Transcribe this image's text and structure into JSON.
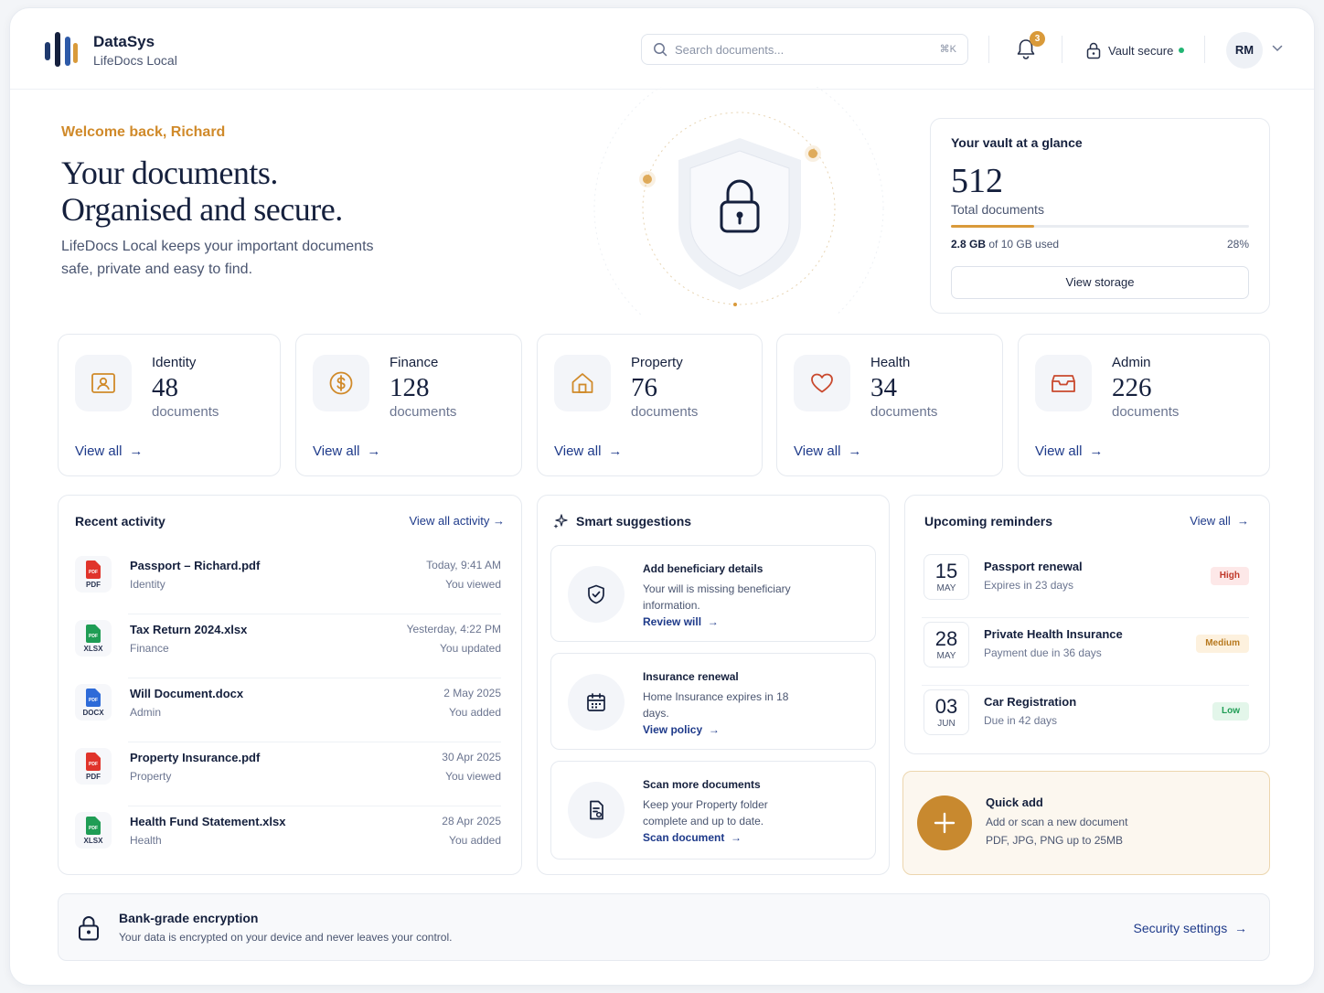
{
  "brand": {
    "name": "DataSys",
    "product": "LifeDocs Local"
  },
  "header": {
    "search_placeholder": "Search documents...",
    "search_shortcut": "⌘K",
    "notification_count": "3",
    "vault_status": "Vault secure",
    "user_initials": "RM"
  },
  "hero": {
    "welcome": "Welcome back, Richard",
    "title_line1": "Your documents.",
    "title_line2": "Organised and secure.",
    "description": "LifeDocs Local keeps your important documents safe, private and easy to find."
  },
  "glance": {
    "title": "Your vault at a glance",
    "total": "512",
    "total_label": "Total documents",
    "used_amount": "2.8 GB",
    "used_suffix": "of 10 GB used",
    "percent": "28%",
    "percent_value": 0.28,
    "button": "View storage"
  },
  "categories": [
    {
      "name": "Identity",
      "count": "48",
      "unit": "documents",
      "link": "View all",
      "icon": "id-card-icon"
    },
    {
      "name": "Finance",
      "count": "128",
      "unit": "documents",
      "link": "View all",
      "icon": "dollar-coin-icon"
    },
    {
      "name": "Property",
      "count": "76",
      "unit": "documents",
      "link": "View all",
      "icon": "house-icon"
    },
    {
      "name": "Health",
      "count": "34",
      "unit": "documents",
      "link": "View all",
      "icon": "heart-icon"
    },
    {
      "name": "Admin",
      "count": "226",
      "unit": "documents",
      "link": "View all",
      "icon": "inbox-tray-icon"
    }
  ],
  "recent_activity": {
    "title": "Recent activity",
    "link": "View all activity",
    "items": [
      {
        "name": "Passport – Richard.pdf",
        "category": "Identity",
        "time": "Today, 9:41 AM",
        "action": "You viewed",
        "ext": "PDF"
      },
      {
        "name": "Tax Return 2024.xlsx",
        "category": "Finance",
        "time": "Yesterday, 4:22 PM",
        "action": "You updated",
        "ext": "XLSX"
      },
      {
        "name": "Will Document.docx",
        "category": "Admin",
        "time": "2 May 2025",
        "action": "You added",
        "ext": "DOCX"
      },
      {
        "name": "Property Insurance.pdf",
        "category": "Property",
        "time": "30 Apr 2025",
        "action": "You viewed",
        "ext": "PDF"
      },
      {
        "name": "Health Fund Statement.xlsx",
        "category": "Health",
        "time": "28 Apr 2025",
        "action": "You added",
        "ext": "XLSX"
      }
    ]
  },
  "suggestions": {
    "title": "Smart suggestions",
    "items": [
      {
        "title": "Add beneficiary details",
        "desc": "Your will is missing beneficiary information.",
        "link": "Review will",
        "icon": "shield-check-icon"
      },
      {
        "title": "Insurance renewal",
        "desc": "Home Insurance expires in 18 days.",
        "link": "View policy",
        "icon": "calendar-icon"
      },
      {
        "title": "Scan more documents",
        "desc": "Keep your Property folder complete and up to date.",
        "link": "Scan document",
        "icon": "scan-document-icon"
      }
    ]
  },
  "reminders": {
    "title": "Upcoming reminders",
    "link": "View all",
    "items": [
      {
        "day": "15",
        "month": "MAY",
        "title": "Passport renewal",
        "sub": "Expires in 23 days",
        "priority": "High"
      },
      {
        "day": "28",
        "month": "MAY",
        "title": "Private Health Insurance",
        "sub": "Payment due in 36 days",
        "priority": "Medium"
      },
      {
        "day": "03",
        "month": "JUN",
        "title": "Car Registration",
        "sub": "Due in 42 days",
        "priority": "Low"
      }
    ]
  },
  "quick_add": {
    "title": "Quick add",
    "desc": "Add or scan a new document",
    "formats": "PDF, JPG, PNG up to 25MB"
  },
  "security": {
    "title": "Bank-grade encryption",
    "desc": "Your data is encrypted on your device and never leaves your control.",
    "link": "Security settings"
  },
  "colors": {
    "accent": "#d99a3a",
    "navy": "#15203d",
    "link": "#1e3a8a",
    "high_bg": "#fde8e8",
    "high_fg": "#c0392b",
    "medium_bg": "#fdf1de",
    "medium_fg": "#b7791f",
    "low_bg": "#e3f6ea",
    "low_fg": "#1f9d55"
  }
}
